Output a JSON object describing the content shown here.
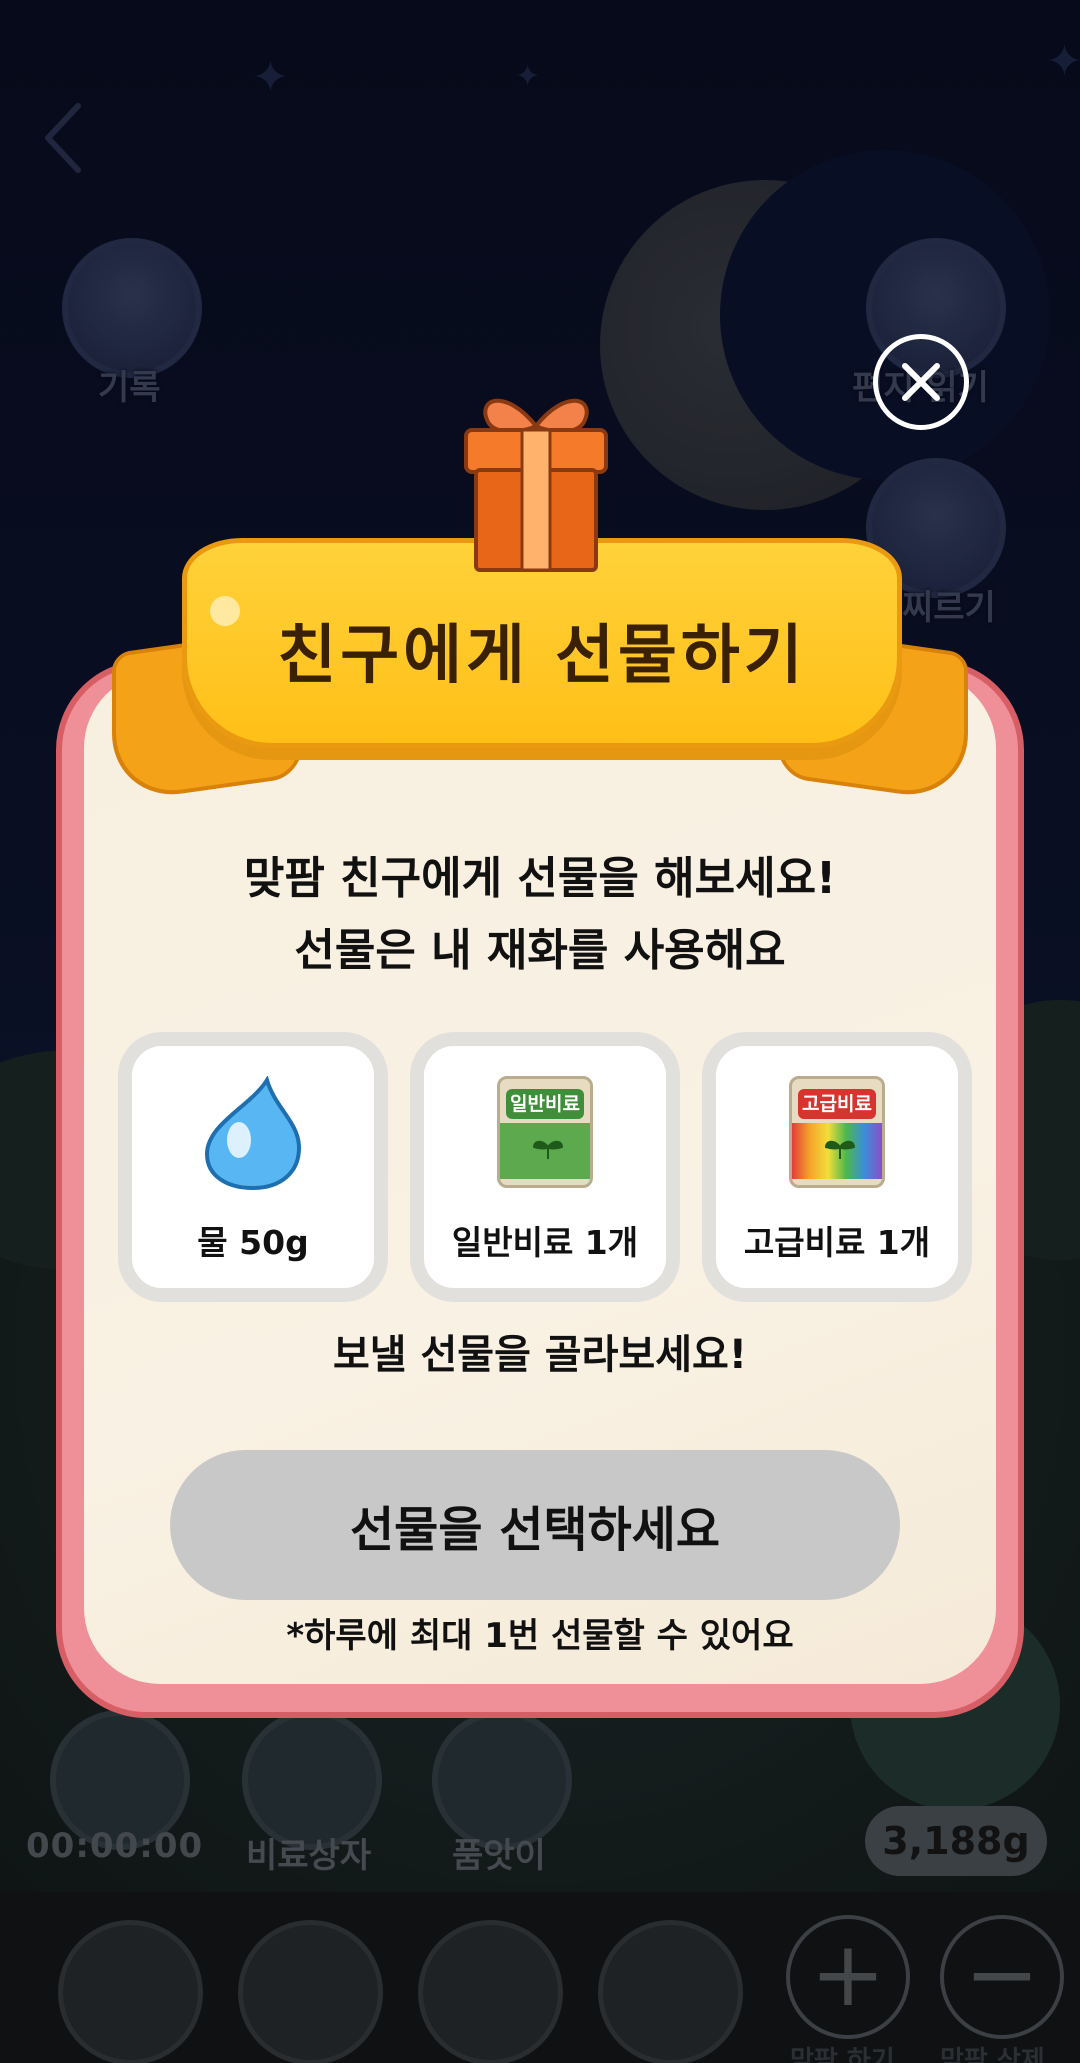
{
  "background": {
    "side_buttons": {
      "record_label": "기록",
      "letter_label": "편지 읽기",
      "poke_label": "찌르기"
    },
    "bottom_actions": {
      "timer": "00:00:00",
      "fertilizer_box_label": "비료상자",
      "helper_label": "품앗이"
    },
    "water_amount": "3,188g",
    "tray": {
      "add_friend_label": "맞팜 하기",
      "remove_friend_label": "맞팜 삭제"
    }
  },
  "modal": {
    "title": "친구에게 선물하기",
    "description_line1": "맞팜 친구에게 선물을 해보세요!",
    "description_line2": "선물은 내 재화를 사용해요",
    "items": [
      {
        "label": "물 50g",
        "icon": "water-drop-icon"
      },
      {
        "label": "일반비료 1개",
        "icon": "normal-fertilizer-icon",
        "tag": "일반비료"
      },
      {
        "label": "고급비료 1개",
        "icon": "premium-fertilizer-icon",
        "tag": "고급비료"
      }
    ],
    "choose_prompt": "보낼 선물을 골라보세요!",
    "submit_label": "선물을 선택하세요",
    "limit_note": "*하루에 최대 1번 선물할 수 있어요"
  },
  "colors": {
    "ribbon": "#ffc21c",
    "card_border": "#ef8f97",
    "card_bg": "#f8f0e2",
    "disabled_button": "#c8c8c8"
  }
}
